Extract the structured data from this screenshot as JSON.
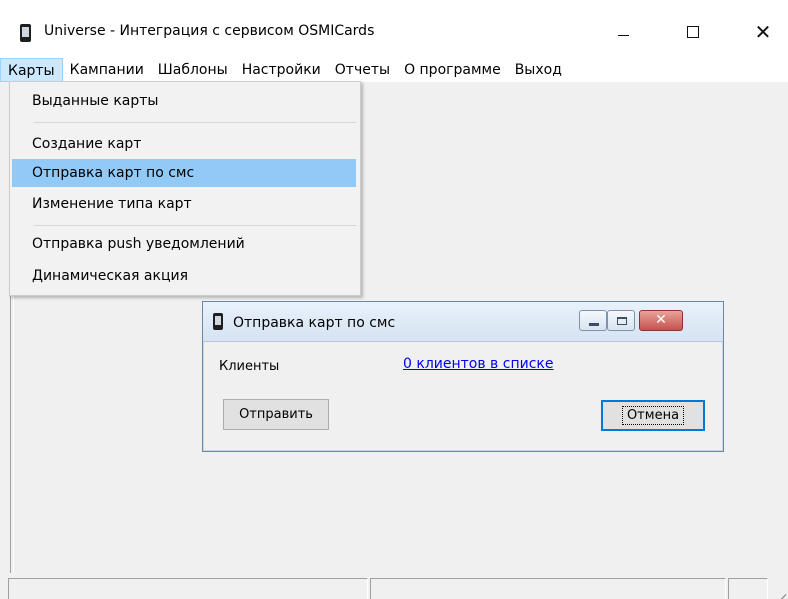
{
  "window": {
    "title": "Universe - Интеграция с сервисом OSMICards",
    "controls": {
      "minimize": "–",
      "maximize": "☐",
      "close": "✕"
    }
  },
  "menubar": {
    "items": [
      {
        "label": "Карты",
        "active": true
      },
      {
        "label": "Кампании"
      },
      {
        "label": "Шаблоны"
      },
      {
        "label": "Настройки"
      },
      {
        "label": "Отчеты"
      },
      {
        "label": "О программе"
      },
      {
        "label": "Выход"
      }
    ]
  },
  "dropdown": {
    "items": [
      {
        "label": "Выданные карты"
      },
      {
        "label": "Создание карт"
      },
      {
        "label": "Отправка карт по смс",
        "highlighted": true
      },
      {
        "label": "Изменение типа карт"
      },
      {
        "label": "Отправка push уведомлений"
      },
      {
        "label": "Динамическая акция"
      }
    ]
  },
  "dialog": {
    "title": "Отправка карт по смс",
    "clients_label": "Клиенты",
    "clients_link": "0 клиентов в списке",
    "send_button": "Отправить",
    "cancel_button": "Отмена",
    "close_glyph": "✕"
  },
  "colors": {
    "menu_highlight": "#91c9f7",
    "menubar_active": "#cce8ff",
    "link": "#0000ee",
    "default_button_border": "#0078d7",
    "client_background": "#f0f0f0"
  },
  "icons": {
    "app": "phone-icon",
    "dialog": "phone-icon"
  }
}
